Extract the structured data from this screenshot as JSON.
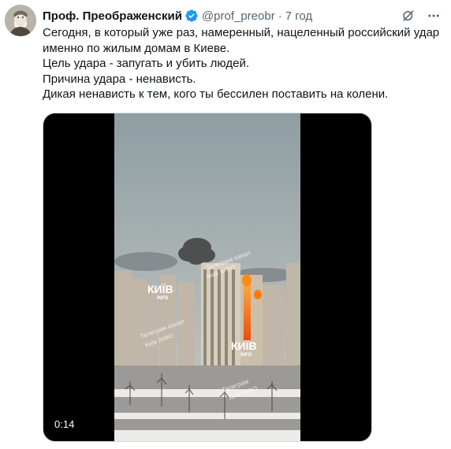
{
  "author": {
    "display_name": "Проф. Преображенский",
    "handle": "@prof_preobr",
    "separator": "·",
    "time": "7 год"
  },
  "tweet_text": [
    "Сегодня, в который уже раз, намеренный, нацеленный российский удар",
    "именно по жилым домам в Киеве.",
    "Цель удара - запугать и убить людей.",
    "Причина удара - ненависть.",
    "Дикая ненависть к тем, кого ты бессилен поставить на колени."
  ],
  "media": {
    "duration": "0:14",
    "watermarks": {
      "logo_main": "КИЇВ",
      "logo_sub": "INFO",
      "channel_1": "Телеграм канал",
      "channel_1b": "Київ ІНФО",
      "channel_2": "Телеграм канал",
      "channel_2b": "Київ ІНФО",
      "channel_3": "Телеграм",
      "channel_3b": "Київ ІНФО"
    }
  },
  "icons": {
    "verified": "verified-badge-icon",
    "grok": "grok-icon",
    "more": "more-icon"
  },
  "colors": {
    "text": "#0f1419",
    "secondary": "#536471",
    "verified_blue": "#1d9bf0",
    "fire": "#ff6a00"
  }
}
